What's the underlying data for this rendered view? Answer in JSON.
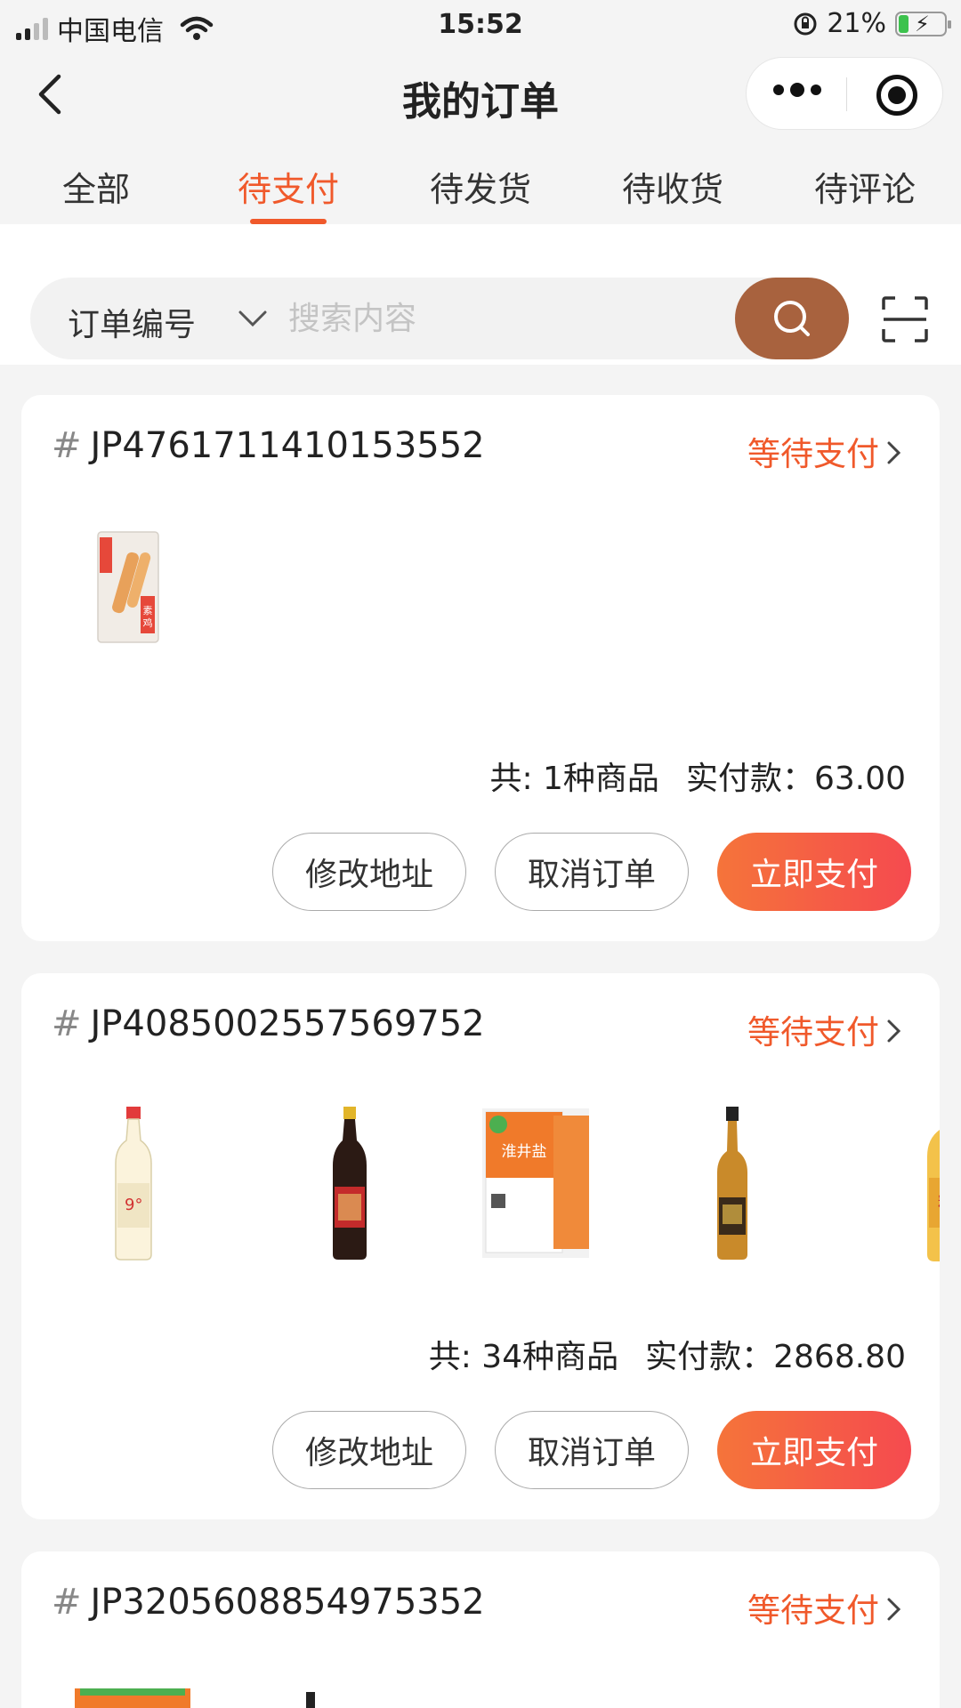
{
  "status_bar": {
    "carrier": "中国电信",
    "time": "15:52",
    "battery": "21%",
    "battery_level": 0.21
  },
  "nav": {
    "title": "我的订单"
  },
  "tabs": [
    {
      "label": "全部",
      "active": false
    },
    {
      "label": "待支付",
      "active": true
    },
    {
      "label": "待发货",
      "active": false
    },
    {
      "label": "待收货",
      "active": false
    },
    {
      "label": "待评论",
      "active": false
    }
  ],
  "search": {
    "type_label": "订单编号",
    "placeholder": "搜索内容"
  },
  "orders": [
    {
      "hash": "#",
      "number": "JP4761711410153552",
      "status": "等待支付",
      "products": [
        "素鸡翅"
      ],
      "summary_count": "共: 1种商品",
      "summary_paid": "实付款：63.00",
      "actions": [
        "修改地址",
        "取消订单",
        "立即支付"
      ]
    },
    {
      "hash": "#",
      "number": "JP4085002557569752",
      "status": "等待支付",
      "products": [
        "9°米醋",
        "镇江香醋",
        "淮井盐",
        "五香料酒",
        "料酒"
      ],
      "summary_count": "共: 34种商品",
      "summary_paid": "实付款：2868.80",
      "actions": [
        "修改地址",
        "取消订单",
        "立即支付"
      ]
    },
    {
      "hash": "#",
      "number": "JP3205608854975352",
      "status": "等待支付"
    }
  ],
  "colors": {
    "accent": "#f0592b",
    "search_button": "#a8623e",
    "background": "#f4f4f4"
  }
}
